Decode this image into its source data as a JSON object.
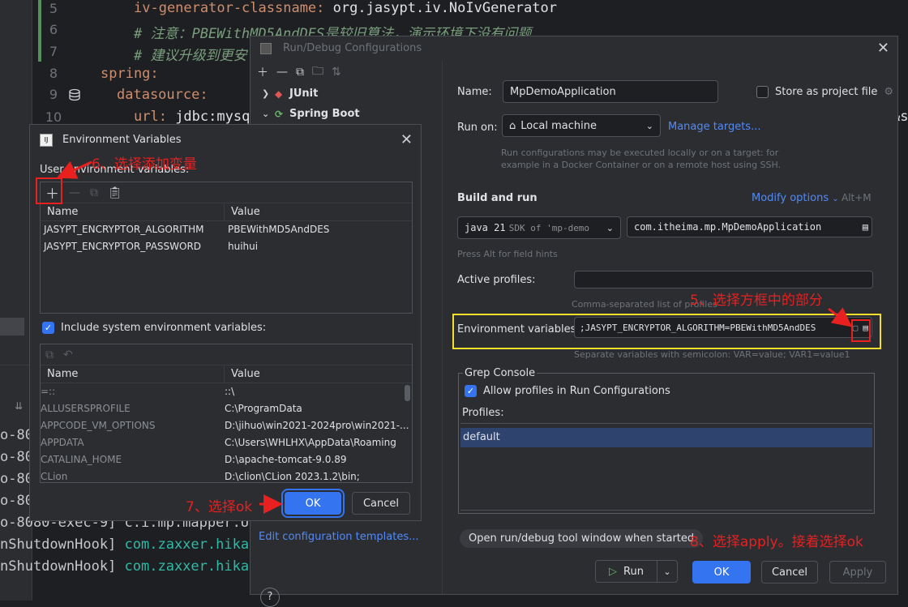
{
  "editor": {
    "line_numbers": [
      "5",
      "6",
      "7",
      "8",
      "9",
      "10"
    ],
    "line5_key": "iv-generator-classname:",
    "line5_val": " org.jasypt.iv.NoIvGenerator",
    "line6_comment": "# 注意：PBEWithMD5AndDES是较旧算法，演示环境下没有问题",
    "line7_comment": "# 建议升级到更安",
    "line8_key": "spring:",
    "line9_key": "datasource:",
    "line10_key": "url:",
    "line10_val": " jdbc:mysql",
    "line10_tail": "&s"
  },
  "run_log": {
    "rows": [
      {
        "prefix": "o-80",
        "text": ""
      },
      {
        "prefix": "o-80",
        "text": ""
      },
      {
        "prefix": "o-80",
        "text": ""
      },
      {
        "prefix": "o-80",
        "text": ""
      },
      {
        "prefix": "o-8080-exec-9] c.i.mp.mapper.Us",
        "text": ""
      },
      {
        "prefix": "nShutdownHook] ",
        "text": "com.zaxxer.hikar"
      },
      {
        "prefix": "nShutdownHook] ",
        "text": "com.zaxxer.hikar"
      }
    ]
  },
  "run_debug": {
    "title": "Run/Debug Configurations",
    "tree": [
      {
        "label": "JUnit",
        "expanded": false
      },
      {
        "label": "Spring Boot",
        "expanded": true
      }
    ],
    "edit_templates": "Edit configuration templates...",
    "name_label": "Name:",
    "name_value": "MpDemoApplication",
    "store_label": "Store as project file",
    "run_on_label": "Run on:",
    "run_on_value": "Local machine",
    "manage_targets": "Manage targets...",
    "run_on_hint": "Run configurations may be executed locally or on a target: for example in a Docker Container or on a remote host using SSH.",
    "build_run": "Build and run",
    "modify_options": "Modify options",
    "modify_shortcut": "Alt+M",
    "java_version": "java 21",
    "sdk_hint": "SDK of 'mp-demo",
    "main_class": "com.itheima.mp.MpDemoApplication",
    "alt_hint": "Press Alt for field hints",
    "active_profiles_label": "Active profiles:",
    "active_profiles_hint": "Comma-separated list of profiles",
    "env_label": "Environment variables:",
    "env_value": ";JASYPT_ENCRYPTOR_ALGORITHM=PBEWithMD5AndDES",
    "env_hint": "Separate variables with semicolon: VAR=value; VAR1=value1",
    "grep_title": "Grep Console",
    "allow_profiles": "Allow profiles in Run Configurations",
    "profiles_label": "Profiles:",
    "profiles": [
      "default"
    ],
    "tip": "Open run/debug tool window when started",
    "run_btn": "Run",
    "ok_btn": "OK",
    "cancel_btn": "Cancel",
    "apply_btn": "Apply"
  },
  "env_dialog": {
    "title": "Environment Variables",
    "user_label": "User environment variables:",
    "col_name": "Name",
    "col_value": "Value",
    "user_vars": [
      {
        "name": "JASYPT_ENCRYPTOR_ALGORITHM",
        "value": "PBEWithMD5AndDES"
      },
      {
        "name": "JASYPT_ENCRYPTOR_PASSWORD",
        "value": "huihui"
      }
    ],
    "include_system": "Include system environment variables:",
    "system_vars": [
      {
        "name": "=::",
        "value": "::\\"
      },
      {
        "name": "ALLUSERSPROFILE",
        "value": "C:\\ProgramData"
      },
      {
        "name": "APPCODE_VM_OPTIONS",
        "value": "D:\\jihuo\\win2021-2024pro\\win2021-..."
      },
      {
        "name": "APPDATA",
        "value": "C:\\Users\\WHLHX\\AppData\\Roaming"
      },
      {
        "name": "CATALINA_HOME",
        "value": "D:\\apache-tomcat-9.0.89"
      },
      {
        "name": "CLion",
        "value": "D:\\clion\\CLion 2023.1.2\\bin;"
      }
    ],
    "ok_btn": "OK",
    "cancel_btn": "Cancel"
  },
  "annotations": {
    "step5": "5、选择方框中的部分",
    "step6": "6、选择添加变量",
    "step7": "7、选择ok",
    "step8": "8、选择apply。接着选择ok"
  }
}
